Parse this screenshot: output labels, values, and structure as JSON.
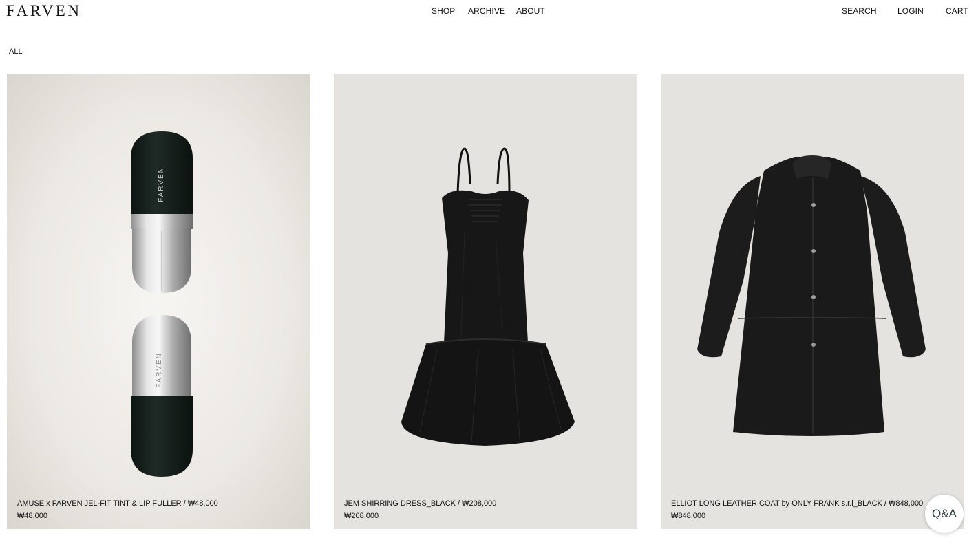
{
  "header": {
    "logo": "FARVEN",
    "nav": {
      "shop": "SHOP",
      "archive": "ARCHIVE",
      "about": "ABOUT"
    },
    "utility": {
      "search": "SEARCH",
      "login": "LOGIN",
      "cart": "CART"
    }
  },
  "filter": {
    "all": "ALL"
  },
  "products": [
    {
      "name": "AMUSE x FARVEN JEL-FIT TINT & LIP FULLER / ₩48,000",
      "price": "₩48,000",
      "image_icon": "lip-tint-capsule-image",
      "brand_mark": "FARVEN"
    },
    {
      "name": "JEM SHIRRING DRESS_BLACK / ₩208,000",
      "price": "₩208,000",
      "image_icon": "black-dress-image"
    },
    {
      "name": "ELLIOT LONG LEATHER COAT by ONLY FRANK s.r.l_BLACK / ₩848,000",
      "price": "₩848,000",
      "image_icon": "black-leather-coat-image"
    }
  ],
  "qa_button": {
    "label": "Q&A"
  },
  "colors": {
    "text": "#111111",
    "card_bg": "#e4e3df",
    "product_black": "#161616"
  }
}
